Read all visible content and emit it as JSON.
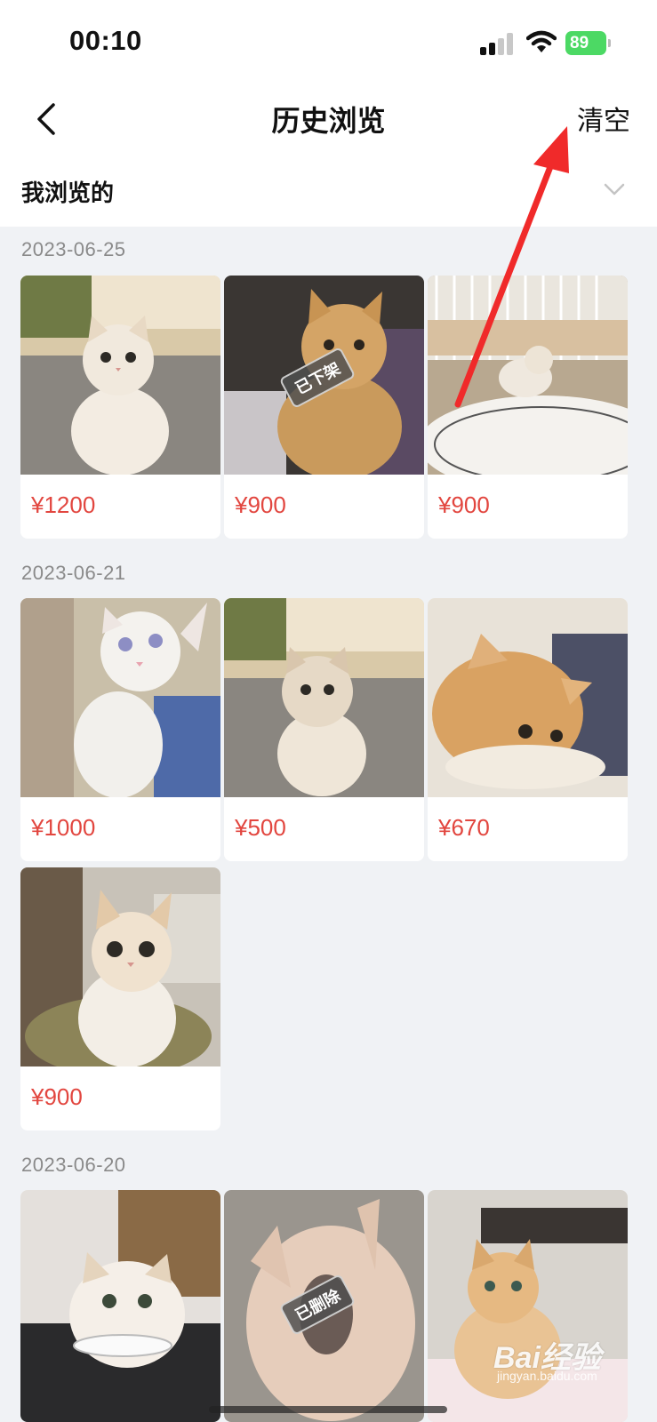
{
  "status_bar": {
    "time": "00:10",
    "battery": "89"
  },
  "nav": {
    "title": "历史浏览",
    "clear_label": "清空"
  },
  "filter": {
    "label": "我浏览的"
  },
  "groups": [
    {
      "date": "2023-06-25",
      "items": [
        {
          "price": "¥1200",
          "tag": ""
        },
        {
          "price": "¥900",
          "tag": "已下架"
        },
        {
          "price": "¥900",
          "tag": ""
        }
      ]
    },
    {
      "date": "2023-06-21",
      "items": [
        {
          "price": "¥1000",
          "tag": ""
        },
        {
          "price": "¥500",
          "tag": ""
        },
        {
          "price": "¥670",
          "tag": ""
        },
        {
          "price": "¥900",
          "tag": ""
        }
      ]
    },
    {
      "date": "2023-06-20",
      "items": [
        {
          "price": "",
          "tag": ""
        },
        {
          "price": "",
          "tag": "已删除"
        },
        {
          "price": "",
          "tag": ""
        }
      ]
    }
  ],
  "watermark": {
    "brand": "Bai经验",
    "url": "jingyan.baidu.com"
  },
  "colors": {
    "price": "#e2463f",
    "page_bg": "#f0f2f5",
    "annotation": "#f02a2a"
  }
}
